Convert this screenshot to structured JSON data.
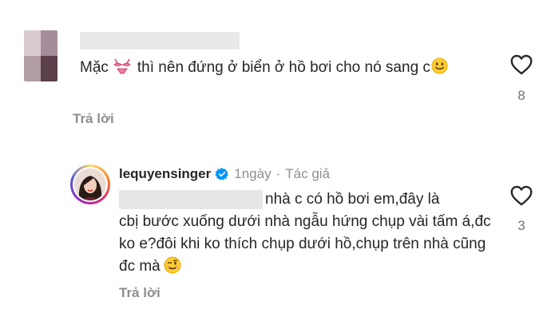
{
  "comment1": {
    "text_before_emoji": "Mặc",
    "emoji_1": "bikini-emoji",
    "text_after_emoji": "thì nên đứng ở biển ở hồ bơi cho nó sang c",
    "emoji_2": "slightly-smiling-emoji",
    "reply_label": "Trả lời",
    "like_count": "8"
  },
  "comment2": {
    "username": "lequyensinger",
    "verified_icon": "verified-badge-icon",
    "time": "1ngày",
    "separator": "·",
    "author_label": "Tác giả",
    "text_line1": "nhà c có hồ bơi em,đây là",
    "text_rest": "cbị bước xuống dưới nhà ngẫu hứng chụp vài tấm á,đc ko e?đôi khi ko thích chụp dưới hồ,chụp trên nhà cũng đc mà",
    "emoji": "winking-emoji",
    "reply_label": "Trả lời",
    "like_count": "3"
  },
  "colors": {
    "text": "#262626",
    "secondary": "#8e8e8e",
    "verified": "#0095f6"
  }
}
